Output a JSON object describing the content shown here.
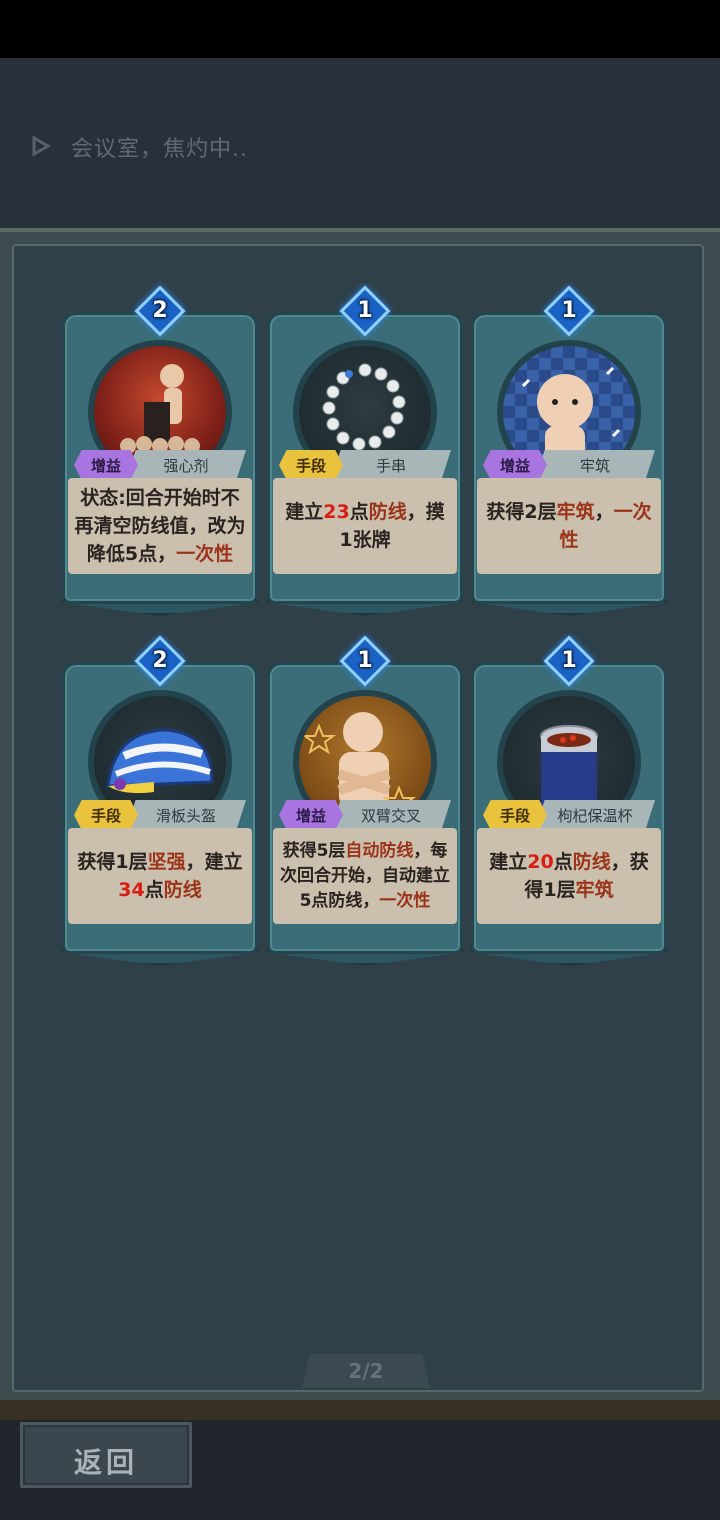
{
  "header": {
    "status_text": "会议室，焦灼中.."
  },
  "cards": [
    {
      "cost": "2",
      "type": "增益",
      "name": "强心剂",
      "desc": [
        {
          "t": "状态:回合开始时不再清空防线值，改为降低5点，"
        },
        {
          "t": "一次性",
          "c": "brown"
        }
      ]
    },
    {
      "cost": "1",
      "type": "手段",
      "name": "手串",
      "desc": [
        {
          "t": "建立"
        },
        {
          "t": "23",
          "c": "red"
        },
        {
          "t": "点"
        },
        {
          "t": "防线",
          "c": "brown"
        },
        {
          "t": "，摸1张牌"
        }
      ]
    },
    {
      "cost": "1",
      "type": "增益",
      "name": "牢筑",
      "desc": [
        {
          "t": "获得2层"
        },
        {
          "t": "牢筑",
          "c": "brown"
        },
        {
          "t": "，"
        },
        {
          "t": "一次性",
          "c": "brown"
        }
      ]
    },
    {
      "cost": "2",
      "type": "手段",
      "name": "滑板头盔",
      "desc": [
        {
          "t": "获得1层"
        },
        {
          "t": "坚强",
          "c": "brown"
        },
        {
          "t": "，建立"
        },
        {
          "t": "34",
          "c": "red"
        },
        {
          "t": "点"
        },
        {
          "t": "防线",
          "c": "brown"
        }
      ]
    },
    {
      "cost": "1",
      "type": "增益",
      "name": "双臂交叉",
      "desc": [
        {
          "t": "获得5层"
        },
        {
          "t": "自动防线",
          "c": "brown"
        },
        {
          "t": "，每次回合开始，自动建立5点防线，"
        },
        {
          "t": "一次性",
          "c": "brown"
        }
      ]
    },
    {
      "cost": "1",
      "type": "手段",
      "name": "枸杞保温杯",
      "desc": [
        {
          "t": "建立"
        },
        {
          "t": "20",
          "c": "red"
        },
        {
          "t": "点"
        },
        {
          "t": "防线",
          "c": "brown"
        },
        {
          "t": "，获得1层"
        },
        {
          "t": "牢筑",
          "c": "brown"
        }
      ]
    }
  ],
  "pagination": {
    "label": "2/2"
  },
  "footer": {
    "back_label": "返回"
  },
  "colors": {
    "buff_tag": "#a875e0",
    "action_tag": "#e9c33d",
    "highlight_red": "#d81e14",
    "highlight_brown": "#9b3419"
  },
  "icons": {
    "play": "play-icon",
    "cost": "diamond-cost-icon"
  }
}
